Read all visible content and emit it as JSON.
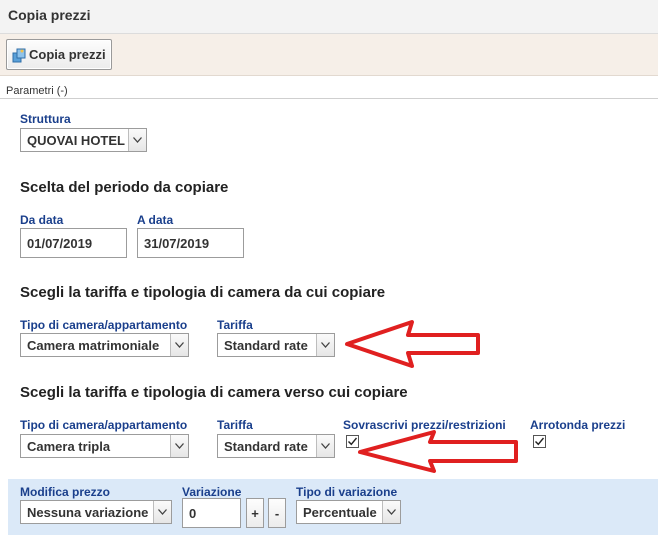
{
  "page": {
    "title": "Copia prezzi"
  },
  "toolbar": {
    "copy_button_label": "Copia prezzi"
  },
  "params": {
    "section_label": "Parametri (-)"
  },
  "structure": {
    "label": "Struttura",
    "selected": "QUOVAI HOTEL"
  },
  "period": {
    "heading": "Scelta del periodo da copiare",
    "from_label": "Da data",
    "from_value": "01/07/2019",
    "to_label": "A data",
    "to_value": "31/07/2019"
  },
  "source": {
    "heading": "Scegli la tariffa e tipologia di camera da cui copiare",
    "room_label": "Tipo di camera/appartamento",
    "room_selected": "Camera matrimoniale",
    "rate_label": "Tariffa",
    "rate_selected": "Standard rate"
  },
  "target": {
    "heading": "Scegli la tariffa e tipologia di camera verso cui copiare",
    "room_label": "Tipo di camera/appartamento",
    "room_selected": "Camera tripla",
    "rate_label": "Tariffa",
    "rate_selected": "Standard rate",
    "overwrite_label": "Sovrascrivi prezzi/restrizioni",
    "overwrite_checked": true,
    "round_label": "Arrotonda prezzi",
    "round_checked": true
  },
  "modify": {
    "price_label": "Modifica prezzo",
    "price_selected": "Nessuna variazione",
    "variation_label": "Variazione",
    "variation_value": "0",
    "plus_label": "+",
    "minus_label": "-",
    "variation_type_label": "Tipo di variazione",
    "variation_type_selected": "Percentuale"
  },
  "annotations": {
    "arrow_color": "#e02020"
  }
}
